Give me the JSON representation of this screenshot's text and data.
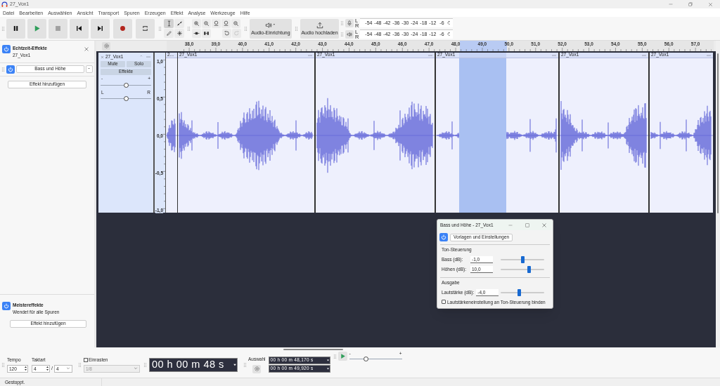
{
  "window": {
    "title": "27_Vox1"
  },
  "menu": [
    "Datei",
    "Bearbeiten",
    "Auswählen",
    "Ansicht",
    "Transport",
    "Spuren",
    "Erzeugen",
    "Effekt",
    "Analyse",
    "Werkzeuge",
    "Hilfe"
  ],
  "toolbar": {
    "tools": [
      {
        "selected": true
      },
      {
        "selected": false
      },
      {
        "selected": false
      },
      {
        "selected": false
      }
    ],
    "audio_setup": "Audio-Einrichtung",
    "audio_upload": "Audio hochladen",
    "meters": [
      {
        "kind": "record",
        "left": "L",
        "right": "R",
        "ticks": [
          "-54",
          "-48",
          "-42",
          "-36",
          "-30",
          "-24",
          "-18",
          "-12",
          "-6"
        ]
      },
      {
        "kind": "playback",
        "left": "L",
        "right": "R",
        "ticks": [
          "-54",
          "-48",
          "-42",
          "-36",
          "-30",
          "-24",
          "-18",
          "-12",
          "-6"
        ]
      }
    ]
  },
  "ruler": {
    "ticks": [
      "38,0",
      "39,0",
      "40,0",
      "41,0",
      "42,0",
      "43,0",
      "44,0",
      "45,0",
      "46,0",
      "47,0",
      "48,0",
      "49,0",
      "50,0",
      "51,0",
      "52,0",
      "53,0",
      "54,0",
      "55,0",
      "56,0",
      "57,0"
    ]
  },
  "realtime_effects": {
    "title": "Echtzeit-Effekte",
    "subtitle": "27_Vox1",
    "effects": [
      {
        "name": "Bass und Höhe",
        "on": true
      }
    ],
    "add_button": "Effekt hinzufügen"
  },
  "master_effects": {
    "title": "Meistereffekte",
    "subtitle": "Wendet für alle Spuren",
    "on": true,
    "add_button": "Effekt hinzufügen"
  },
  "track": {
    "name": "27_Vox1",
    "mute": "Mute",
    "solo": "Solo",
    "effects": "Effekte",
    "gain": {
      "minus": "-",
      "plus": "+",
      "level": 0.5
    },
    "pan": {
      "left": "L",
      "right": "R",
      "level": 0.5
    },
    "scale": [
      "1,0",
      "0,5",
      "0,0",
      "-0,5",
      "-1,0"
    ],
    "clips": [
      "2...",
      "27_Vox1",
      "27_Vox1",
      "27_Vox1",
      "27_Vox1",
      "27_Vox1"
    ]
  },
  "dialog": {
    "title": "Bass und Höhe - 27_Vox1",
    "on": true,
    "presets_button": "Vorlagen und Einstellungen",
    "groups": [
      {
        "title": "Ton-Steuerung",
        "fields": [
          {
            "label": "Bass (dB):",
            "value": "-1,0",
            "level": 0.5
          },
          {
            "label": "Höhen (dB):",
            "value": "10,0",
            "level": 0.65
          }
        ]
      },
      {
        "title": "Ausgabe",
        "fields": [
          {
            "label": "Lautstärke (dB):",
            "value": "-4,0",
            "level": 0.42
          }
        ]
      }
    ],
    "checkbox": {
      "label": "Lautstärkeneinstellung an Ton-Steuerung binden",
      "checked": false
    }
  },
  "bottom": {
    "tempo_label": "Tempo",
    "tempo": "120",
    "time_signature_label": "Taktart",
    "beats": "4",
    "slash": "/",
    "beat_unit": "4",
    "snap": {
      "label": "Einrasten",
      "checked": false,
      "value": "1/8",
      "disabled": true
    },
    "time": "00 h 00 m 48 s",
    "selection_label": "Auswahl",
    "selection_start": "00 h 00 m 48,170 s",
    "selection_end": "00 h 00 m 49,920 s",
    "play_speed": {
      "minus": "-",
      "plus": "+",
      "level": 0.32
    }
  },
  "status_bar": "Gestoppt."
}
